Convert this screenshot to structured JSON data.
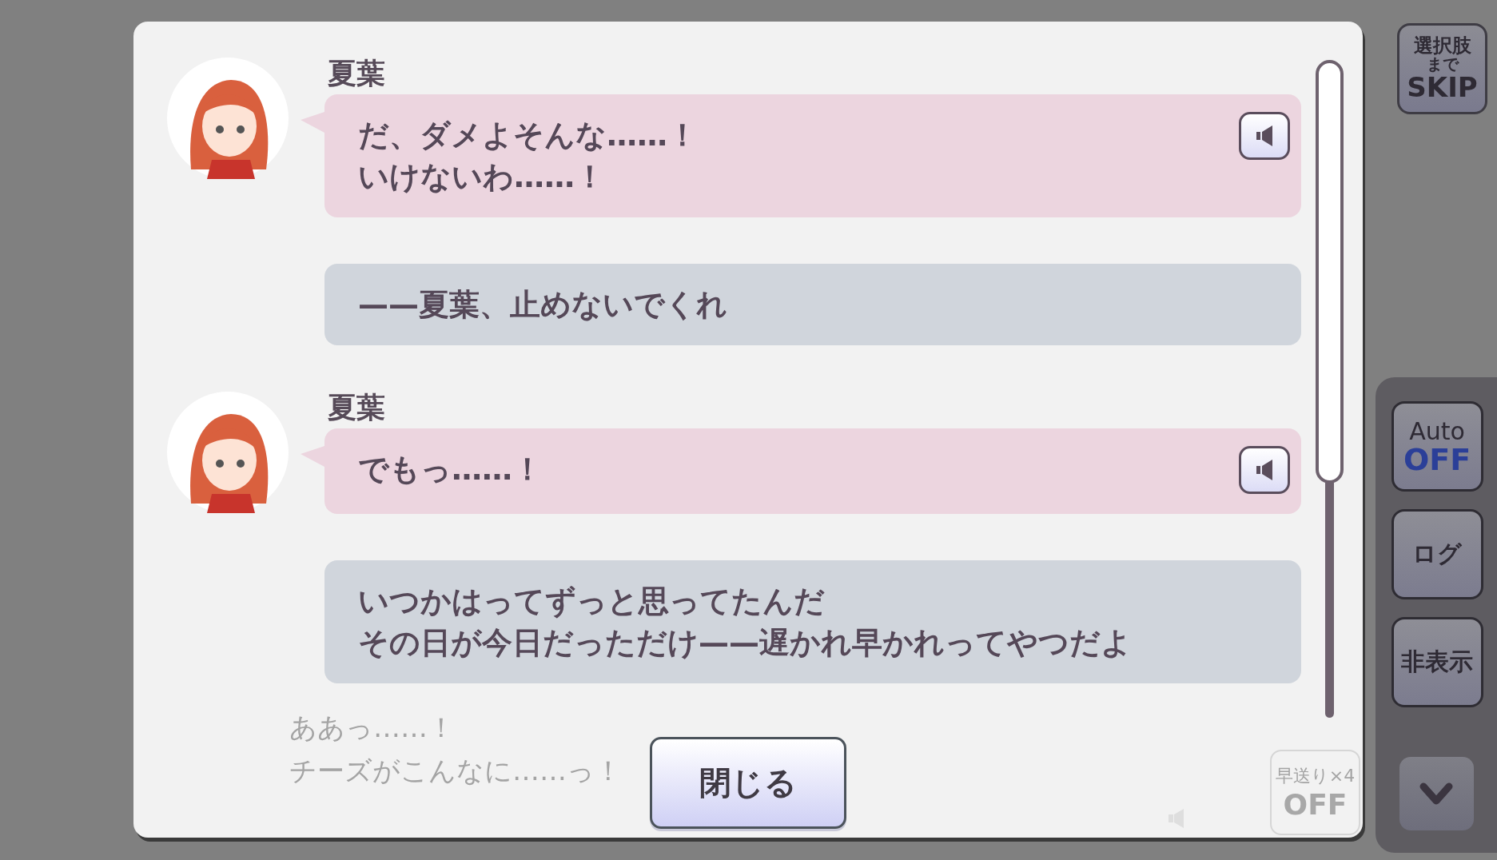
{
  "messages": [
    {
      "kind": "speech",
      "speaker": "夏葉",
      "lines": [
        "だ、ダメよそんな……！",
        "いけないわ……！"
      ]
    },
    {
      "kind": "narration",
      "lines": [
        "——夏葉、止めないでくれ"
      ]
    },
    {
      "kind": "speech",
      "speaker": "夏葉",
      "lines": [
        "でもっ……！"
      ]
    },
    {
      "kind": "narration",
      "lines": [
        "いつかはってずっと思ってたんだ",
        "その日が今日だっただけ——遅かれ早かれってやつだよ"
      ]
    }
  ],
  "close_button": "閉じる",
  "background_dialogue": {
    "lines": [
      "ああっ……！",
      "チーズがこんなに……っ！"
    ],
    "fast_forward": {
      "label": "早送り×4",
      "state": "OFF"
    }
  },
  "skip_button": {
    "lines": [
      "選択肢",
      "まで",
      "SKIP"
    ]
  },
  "side_menu": {
    "auto": {
      "label": "Auto",
      "state": "OFF"
    },
    "buttons": [
      "ログ",
      "非表示"
    ]
  }
}
